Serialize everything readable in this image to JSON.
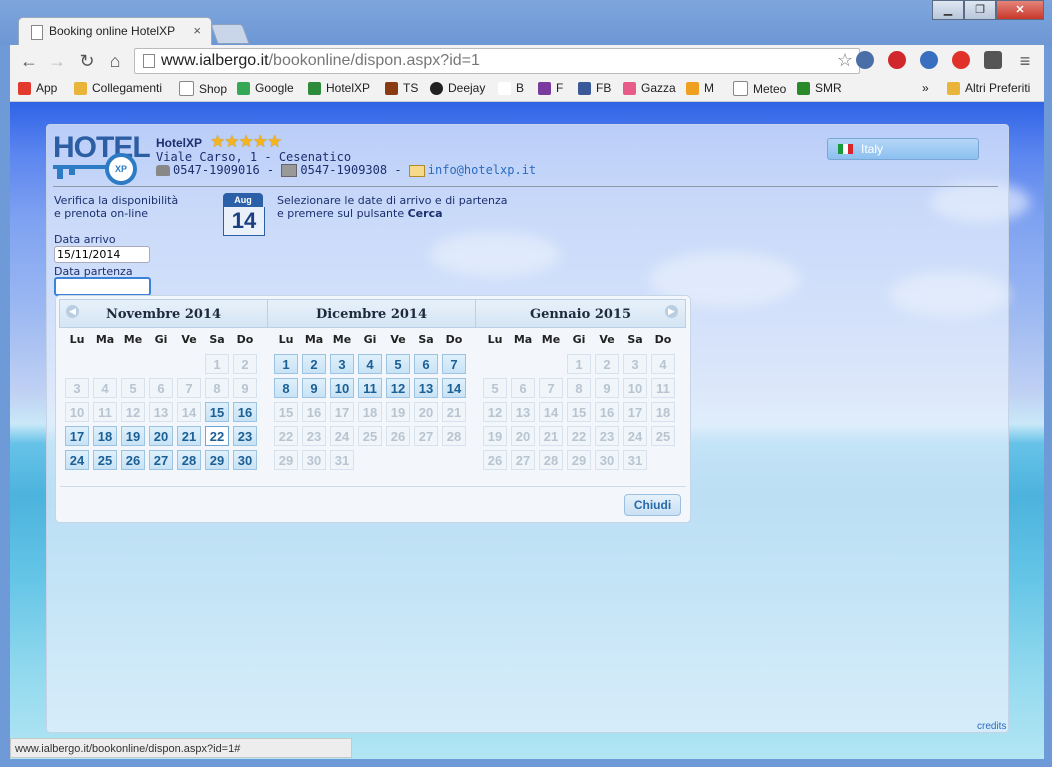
{
  "browser": {
    "tab_title": "Booking online HotelXP",
    "tab_close": "×",
    "url_host": "www.ialbergo.it",
    "url_path": "/bookonline/dispon.aspx?id=1",
    "window_buttons": {
      "minimize": "▁",
      "maximize": "❐",
      "close": "✕"
    },
    "nav": {
      "back": "←",
      "forward": "→",
      "reload": "↻",
      "home": "⌂"
    },
    "star": "☆",
    "menu": "≡",
    "bookmarks": [
      {
        "label": "App",
        "color": "#e23b2e"
      },
      {
        "label": "Collegamenti",
        "color": "#e8b53a"
      },
      {
        "label": "Shop",
        "color": "#ffffff"
      },
      {
        "label": "Google",
        "color": "#34a853"
      },
      {
        "label": "HotelXP",
        "color": "#2e8b3a"
      },
      {
        "label": "TS",
        "color": "#8a3b12"
      },
      {
        "label": "Deejay",
        "color": "#222222"
      },
      {
        "label": "B",
        "color": "#ffffff"
      },
      {
        "label": "F",
        "color": "#7a3b9e"
      },
      {
        "label": "FB",
        "color": "#3b5998"
      },
      {
        "label": "Gazza",
        "color": "#e85c8a"
      },
      {
        "label": "M",
        "color": "#f0a020"
      },
      {
        "label": "Meteo",
        "color": "#ffffff"
      },
      {
        "label": "SMR",
        "color": "#2a8a2a"
      }
    ],
    "bookmarks_more": "»",
    "other_bookmarks": "Altri Preferiti",
    "status_url": "www.ialbergo.it/bookonline/dispon.aspx?id=1#"
  },
  "hotel": {
    "logo_text": "HOTEL",
    "logo_badge": "XP",
    "name": "HotelXP",
    "stars": "★★★★★",
    "address": "Viale Carso, 1 - Cesenatico",
    "phone": "0547-1909016",
    "sep1": " - ",
    "fax": "0547-1909308",
    "sep2": " - ",
    "email": "info@hotelxp.it"
  },
  "language": {
    "label": "Italy"
  },
  "intro": {
    "line1": "Verifica la disponibilità",
    "line2": "e prenota on-line"
  },
  "calendar_icon": {
    "month": "Aug",
    "day": "14"
  },
  "instructions": {
    "line1": "Selezionare le date di arrivo e di partenza",
    "line2": "e premere sul pulsante ",
    "bold": "Cerca"
  },
  "form": {
    "arrival_label": "Data arrivo",
    "arrival_value": "15/11/2014",
    "departure_label": "Data partenza",
    "departure_value": ""
  },
  "datepicker": {
    "prev": "◀",
    "next": "▶",
    "weekdays": [
      "Lu",
      "Ma",
      "Me",
      "Gi",
      "Ve",
      "Sa",
      "Do"
    ],
    "close_label": "Chiudi",
    "months": [
      {
        "title": "Novembre 2014",
        "offset": 5,
        "days": 30,
        "available_from": 15,
        "selected": 22
      },
      {
        "title": "Dicembre 2014",
        "offset": 0,
        "days": 31,
        "available_to": 14
      },
      {
        "title": "Gennaio 2015",
        "offset": 3,
        "days": 31,
        "available_to": 0
      }
    ]
  },
  "footer": {
    "credits": "credits"
  }
}
